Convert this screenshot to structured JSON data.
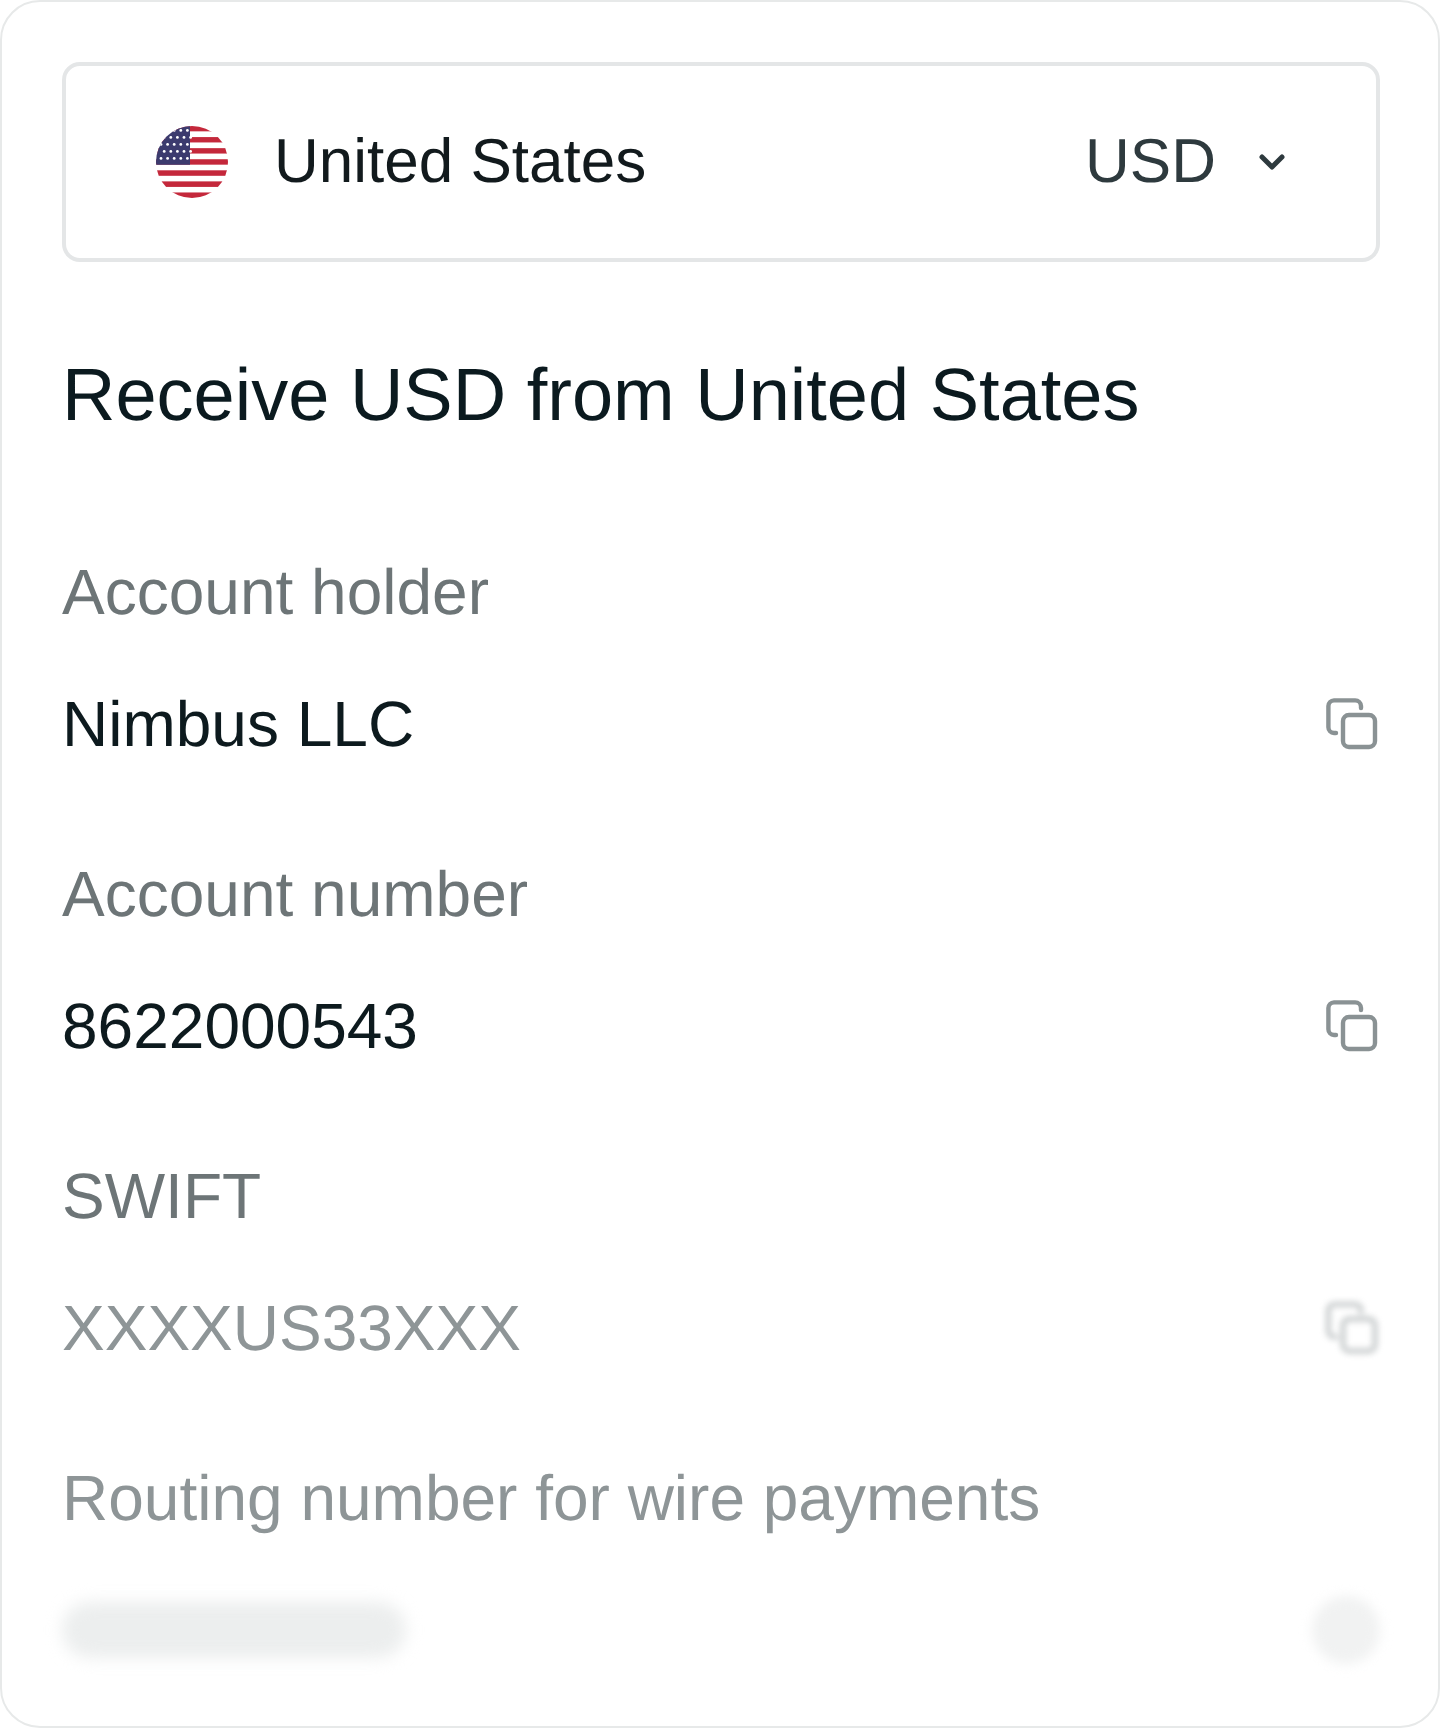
{
  "selector": {
    "country": "United States",
    "currency": "USD"
  },
  "heading": "Receive USD from United States",
  "fields": [
    {
      "label": "Account holder",
      "label_obscured": false,
      "value": "Nimbus LLC",
      "value_obscured": false
    },
    {
      "label": "Account number",
      "label_obscured": false,
      "value": "8622000543",
      "value_obscured": false
    },
    {
      "label": "SWIFT",
      "label_obscured": false,
      "value": "XXXXUS33XXX",
      "value_obscured": true
    },
    {
      "label": "Routing number for wire payments",
      "label_obscured": true,
      "value_obscured": true
    }
  ]
}
